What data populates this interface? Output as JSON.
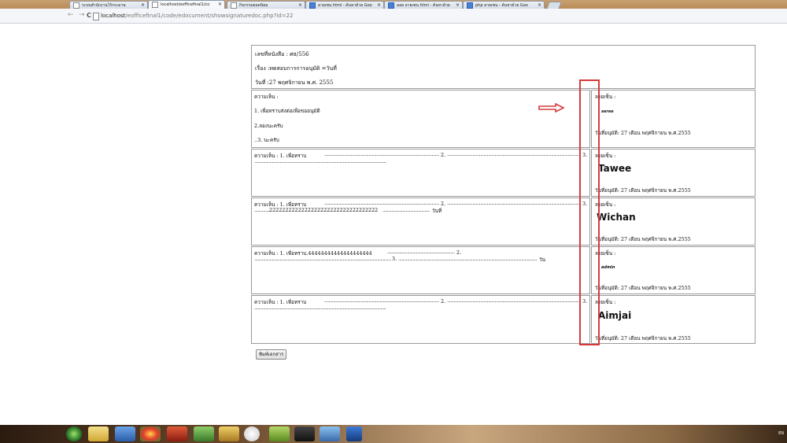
{
  "browser": {
    "tabs": [
      {
        "label": "ระบบสำนักงานไร้กระดาษ",
        "close": "×"
      },
      {
        "label": "localhost/eofficefinal1/co",
        "close": "×"
      },
      {
        "label": "กิจกรรมยอดนิยม",
        "close": "×"
      },
      {
        "label": "ลายเซน html - ค้นหาด้วย Goo",
        "close": "×"
      },
      {
        "label": "ลอย ลายเซน html - ค้นหาด้วย",
        "close": "×"
      },
      {
        "label": "php ลายเซน - ค้นหาด้วย Goo",
        "close": "×"
      }
    ],
    "back": "←",
    "forward": "→",
    "reload": "C",
    "url_host": "localhost",
    "url_path": "/eofficefinal1/code/edocument/showsignaturedoc.php?id=22"
  },
  "doc": {
    "number": "เลขที่หนังสือ : ศธ/556",
    "subject": "เรื่อง :ทดสอบการการอนุมัติ =วันที่",
    "date": "วันที่ :27 พฤศจิกายน พ.ศ. 2555"
  },
  "comment_label": "ความเห็น :",
  "sign_label": "ลายเซ็น :",
  "approve_date": "วันที่อนุมัติ: 27 เดือน พฤศจิกายน พ.ศ.2555",
  "rows": [
    {
      "lines": [
        "1. เพื่อทราบส่งต่อเพื่อขออนุมัติ",
        "2.ลองนะครับ",
        "..3. นะครับ"
      ],
      "signature": "seree"
    },
    {
      "line1": "ความเห็น : 1. เพื่อทราบ",
      "mark2": "2.",
      "mark3": "3.",
      "signature": "Tawee"
    },
    {
      "line1": "ความเห็น : 1. เพื่อทราบ",
      "mark2": "2.",
      "mark3": "3.",
      "line2": "2222222222222222222222222222222222",
      "line2_end": "วันที่",
      "signature": "Wichan"
    },
    {
      "line1": "ความเห็น : 1. เพื่อทราบ.44444444444444444444",
      "mark2": "2.",
      "mark3": "3.",
      "line2_end": "วัน",
      "signature": "admin"
    },
    {
      "line1": "ความเห็น : 1. เพื่อทราบ",
      "mark2": "2.",
      "mark3": "3.",
      "signature": "Aimjai"
    }
  ],
  "print_button": "พิมพ์เอกสาร",
  "tray": {
    "lang": "EN"
  },
  "colors": {
    "annotation_red": "#d63b3b"
  }
}
